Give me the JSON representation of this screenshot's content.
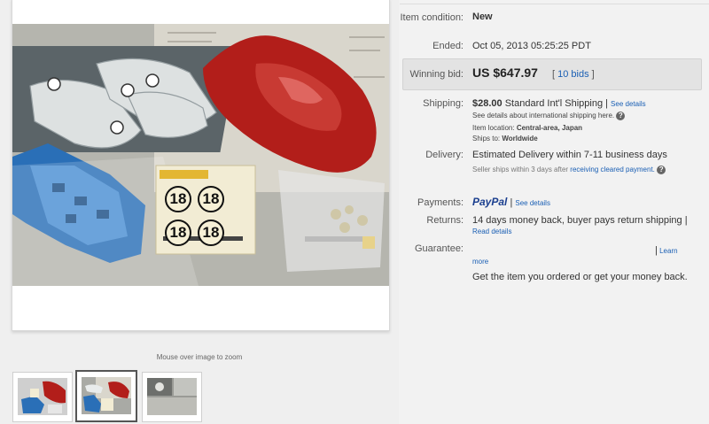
{
  "gallery": {
    "zoom_hint": "Mouse over image to zoom",
    "decal_numbers": [
      "18",
      "18",
      "18",
      "18"
    ]
  },
  "details": {
    "condition_label": "Item condition:",
    "condition_value": "New",
    "ended_label": "Ended:",
    "ended_value": "Oct 05, 2013  05:25:25 PDT",
    "winning_label": "Winning bid:",
    "winning_value": "US $647.97",
    "bids_link": "10 bids",
    "shipping_label": "Shipping:",
    "shipping_cost": "$28.00",
    "shipping_method": "Standard Int'l Shipping |",
    "shipping_details_link": "See details",
    "shipping_intl_note": "See details about international shipping here.",
    "location_label": "Item location:",
    "location_value": "Central-area, Japan",
    "ships_to_label": "Ships to:",
    "ships_to_value": "Worldwide",
    "delivery_label": "Delivery:",
    "delivery_value": "Estimated Delivery within 7-11 business days",
    "delivery_note_a": "Seller ships within 3 days after",
    "delivery_note_link": "receiving cleared payment.",
    "payments_label": "Payments:",
    "paypal_logo": "PayPal",
    "payments_sep": "|",
    "payments_link": "See details",
    "returns_label": "Returns:",
    "returns_value": "14 days money back, buyer pays return shipping |",
    "returns_link": "Read details",
    "guarantee_label": "Guarantee:",
    "guarantee_sep": "|",
    "guarantee_link_a": "Learn",
    "guarantee_link_b": "more",
    "guarantee_text": "Get the item you ordered or get your money back."
  }
}
